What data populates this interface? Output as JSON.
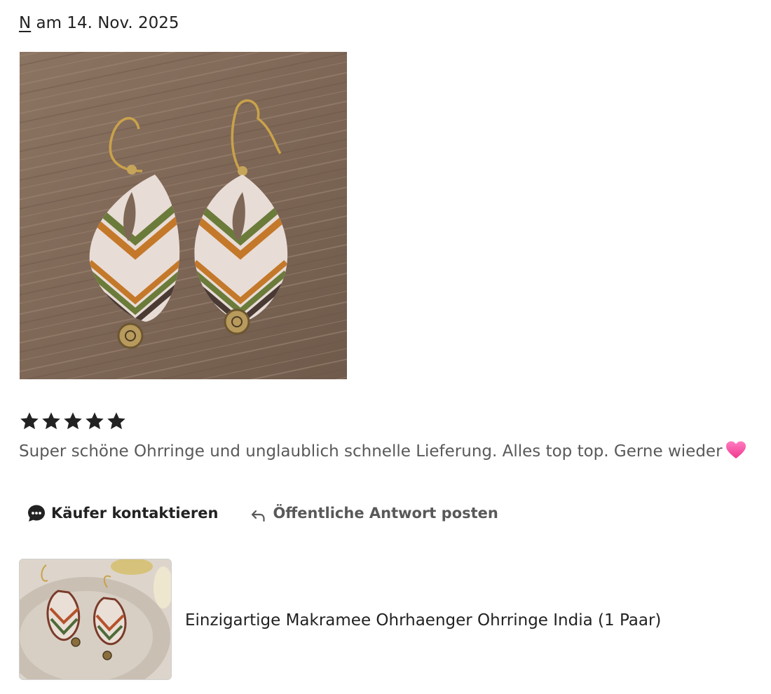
{
  "review": {
    "reviewer_name": "N",
    "date_text": " am 14. Nov. 2025",
    "rating": 5,
    "text": "Super schöne Ohrringe und unglaublich schnelle Lieferung. Alles top top. Gerne wieder",
    "emoji": "pink-heart"
  },
  "actions": {
    "contact_label": "Käufer kontaktieren",
    "reply_label": "Öffentliche Antwort posten"
  },
  "product": {
    "title": "Einzigartige Makramee Ohrhaenger Ohrringe India (1 Paar)"
  },
  "icons": {
    "star": "star-icon",
    "contact": "chat-bubble-icon",
    "reply": "reply-arrow-icon"
  },
  "colors": {
    "text": "#222222",
    "muted_text": "#595959",
    "star": "#222222",
    "heart": "#ff4fa3"
  }
}
